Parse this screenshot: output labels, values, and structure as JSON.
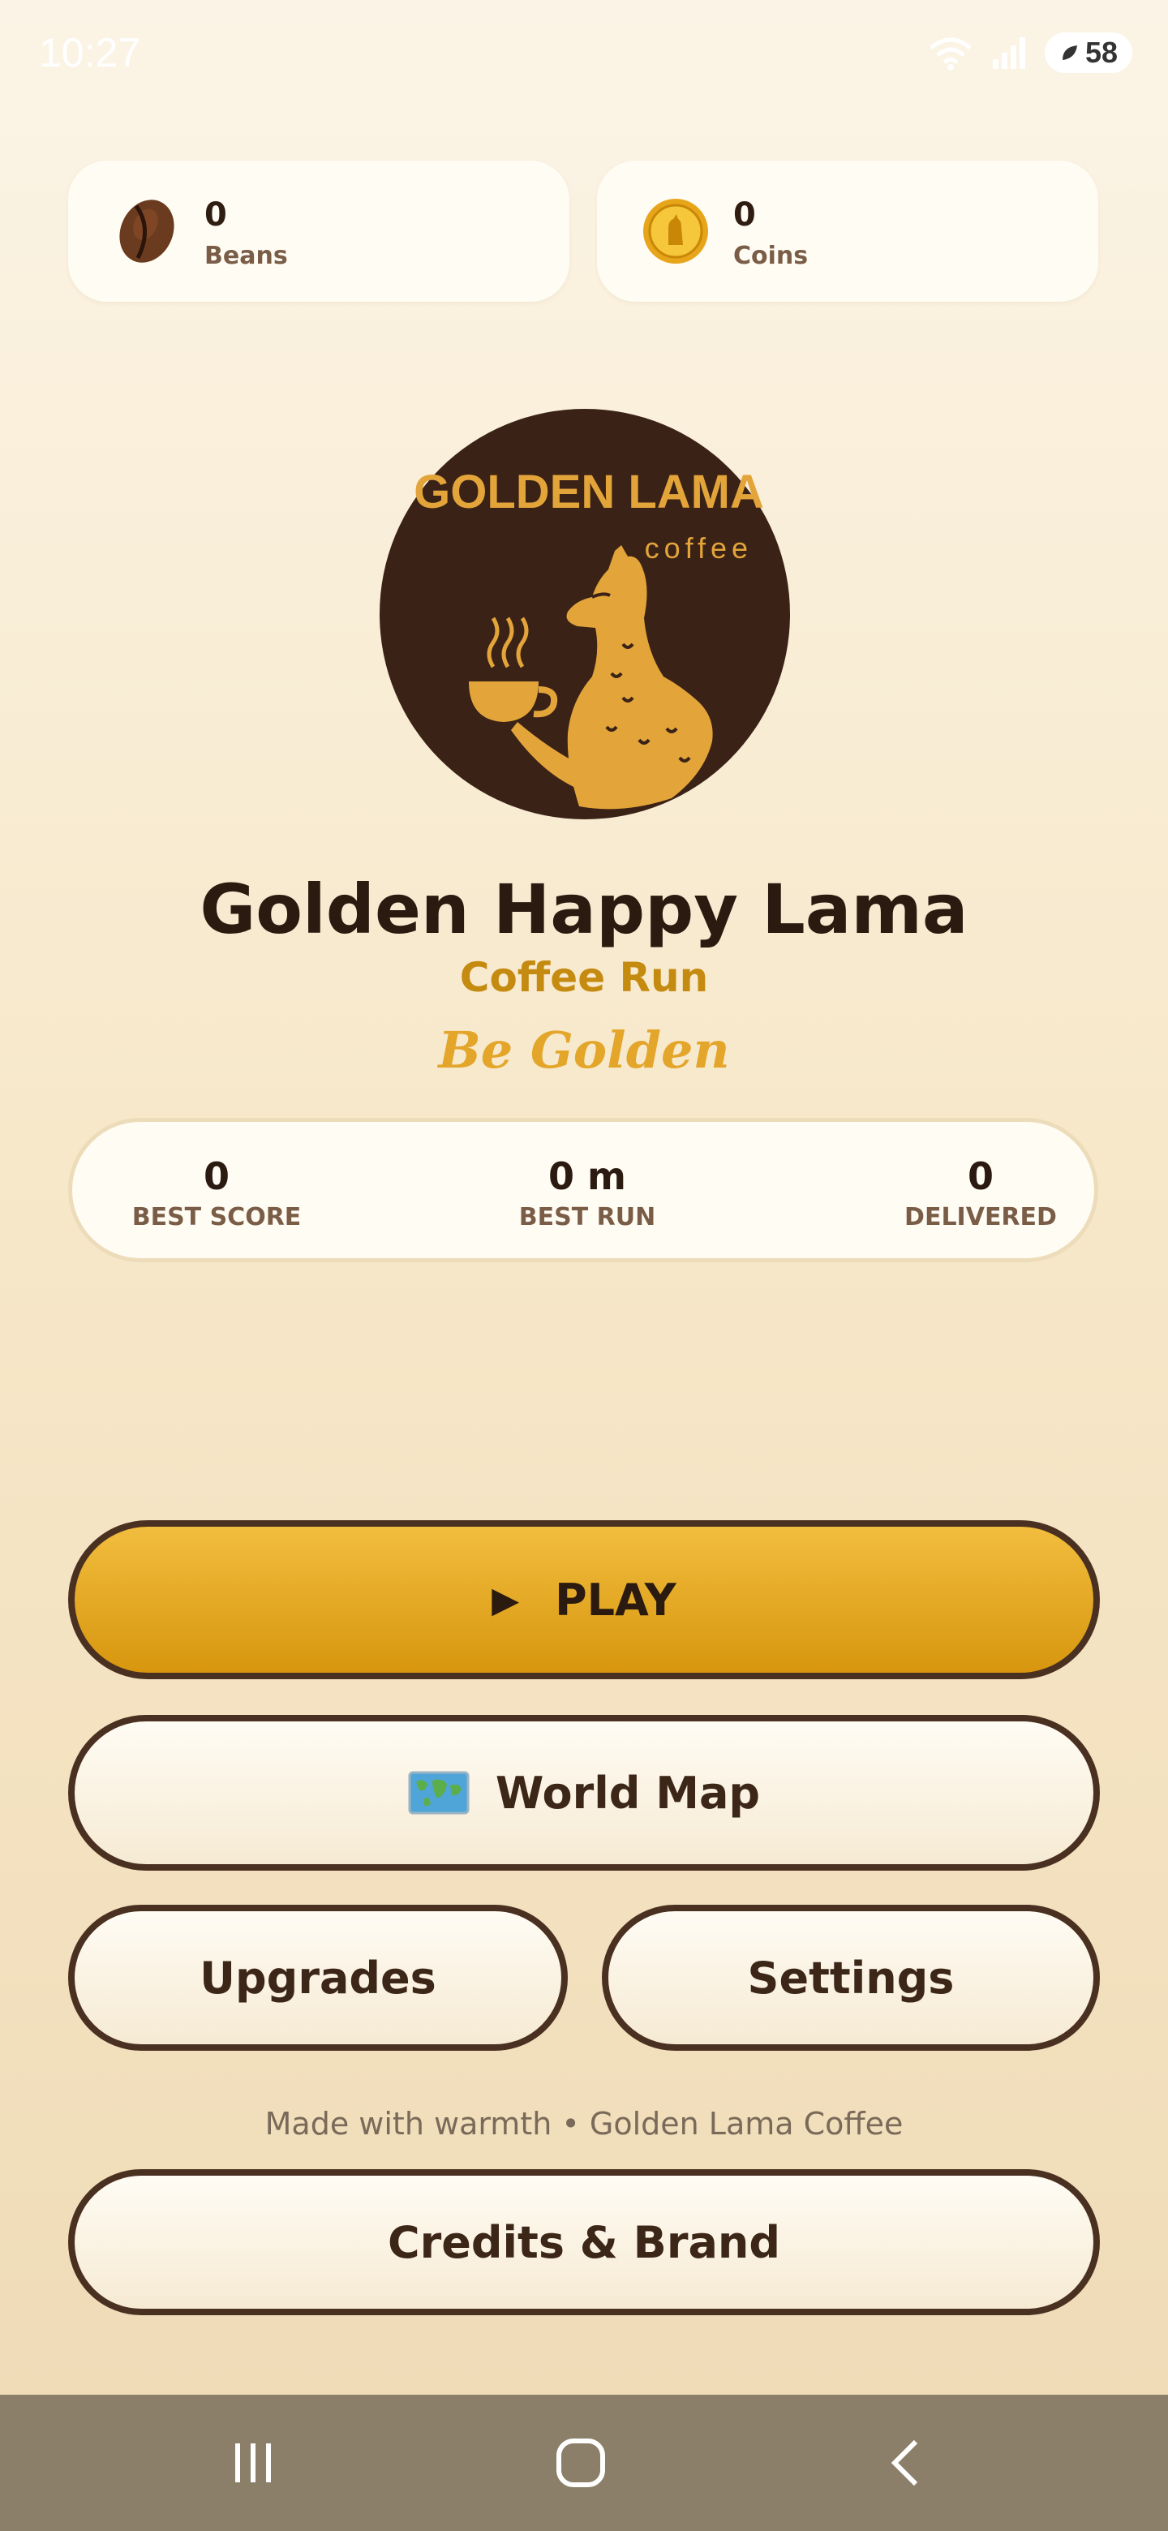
{
  "status": {
    "time": "10:27",
    "battery": "58"
  },
  "currencies": {
    "beans": {
      "value": "0",
      "label": "Beans",
      "icon": "coffee-bean-icon"
    },
    "coins": {
      "value": "0",
      "label": "Coins",
      "icon": "llama-coin-icon"
    }
  },
  "logo": {
    "line1": "GOLDEN LAMA",
    "line2": "coffee"
  },
  "title": "Golden Happy Lama",
  "subtitle": "Coffee Run",
  "tagline": "Be Golden",
  "stats": [
    {
      "value": "0",
      "label": "BEST SCORE"
    },
    {
      "value": "0 m",
      "label": "BEST RUN"
    },
    {
      "value": "0",
      "label": "DELIVERED"
    }
  ],
  "buttons": {
    "play": "PLAY",
    "world_map": "World Map",
    "upgrades": "Upgrades",
    "settings": "Settings",
    "credits": "Credits & Brand"
  },
  "footer": "Made with warmth • Golden Lama Coffee",
  "colors": {
    "brand_gold": "#d7960e",
    "brand_brown": "#3a2216",
    "text_dark": "#2a1a10"
  }
}
